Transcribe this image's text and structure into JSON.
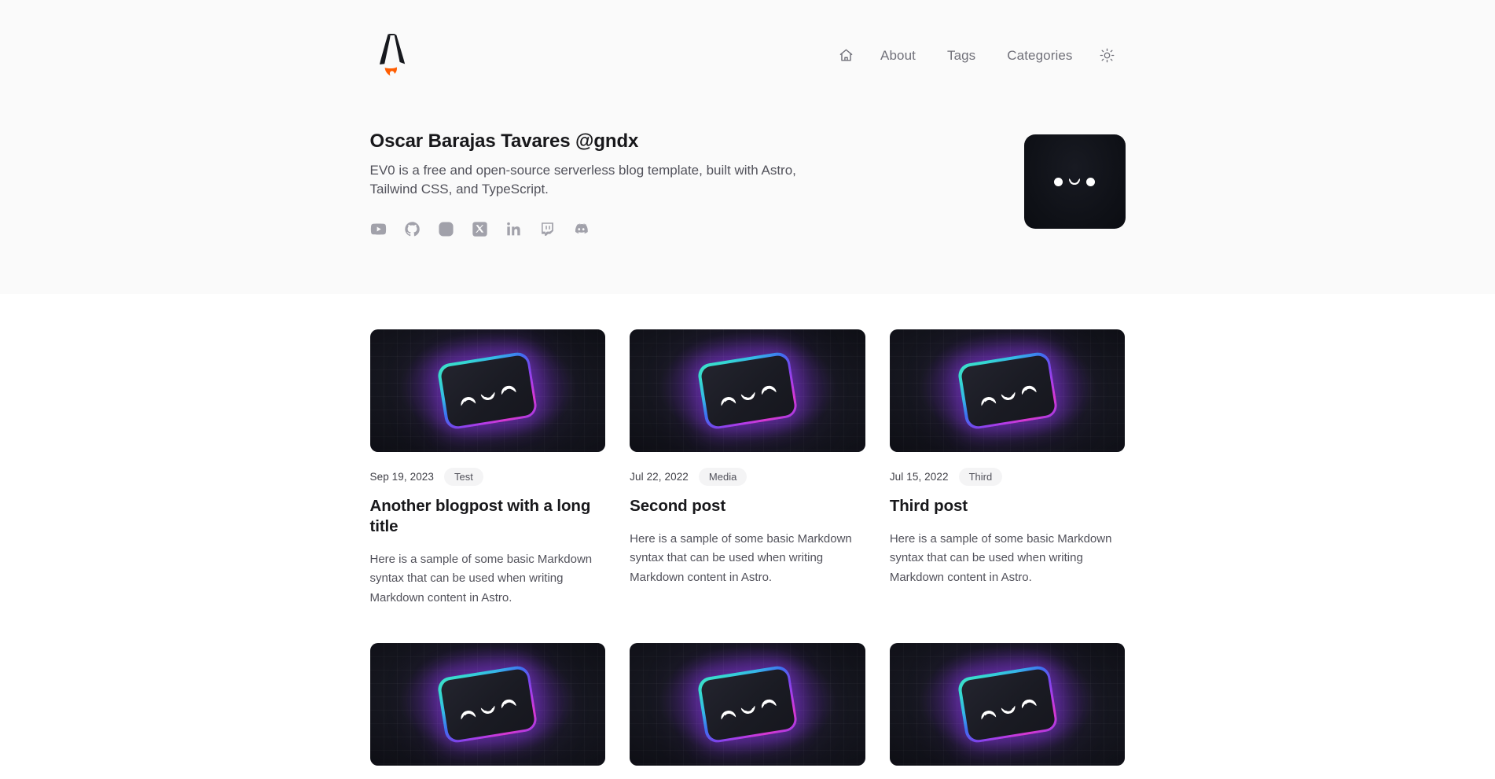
{
  "site": {
    "logo_icon": "astro-logo-icon",
    "background": "#ffffff",
    "hero_background": "#fafafa"
  },
  "nav": {
    "home_icon": "home-icon",
    "theme_icon": "sun-icon",
    "items": [
      {
        "label": "About"
      },
      {
        "label": "Tags"
      },
      {
        "label": "Categories"
      }
    ]
  },
  "profile": {
    "title": "Oscar Barajas Tavares @gndx",
    "description": "EV0 is a free and open-source serverless blog template, built with Astro, Tailwind CSS, and TypeScript.",
    "avatar_icon": "kawaii-face-avatar",
    "socials": [
      {
        "name": "youtube-icon"
      },
      {
        "name": "github-icon"
      },
      {
        "name": "instagram-icon"
      },
      {
        "name": "x-twitter-icon"
      },
      {
        "name": "linkedin-icon"
      },
      {
        "name": "twitch-icon"
      },
      {
        "name": "discord-icon"
      }
    ]
  },
  "posts": [
    {
      "date": "Sep 19, 2023",
      "tag": "Test",
      "title": "Another blogpost with a long title",
      "excerpt": "Here is a sample of some basic Markdown syntax that can be used when writing Markdown content in Astro."
    },
    {
      "date": "Jul 22, 2022",
      "tag": "Media",
      "title": "Second post",
      "excerpt": "Here is a sample of some basic Markdown syntax that can be used when writing Markdown content in Astro."
    },
    {
      "date": "Jul 15, 2022",
      "tag": "Third",
      "title": "Third post",
      "excerpt": "Here is a sample of some basic Markdown syntax that can be used when writing Markdown content in Astro."
    },
    {
      "date": "",
      "tag": "",
      "title": "",
      "excerpt": ""
    },
    {
      "date": "",
      "tag": "",
      "title": "",
      "excerpt": ""
    },
    {
      "date": "",
      "tag": "",
      "title": "",
      "excerpt": ""
    }
  ]
}
